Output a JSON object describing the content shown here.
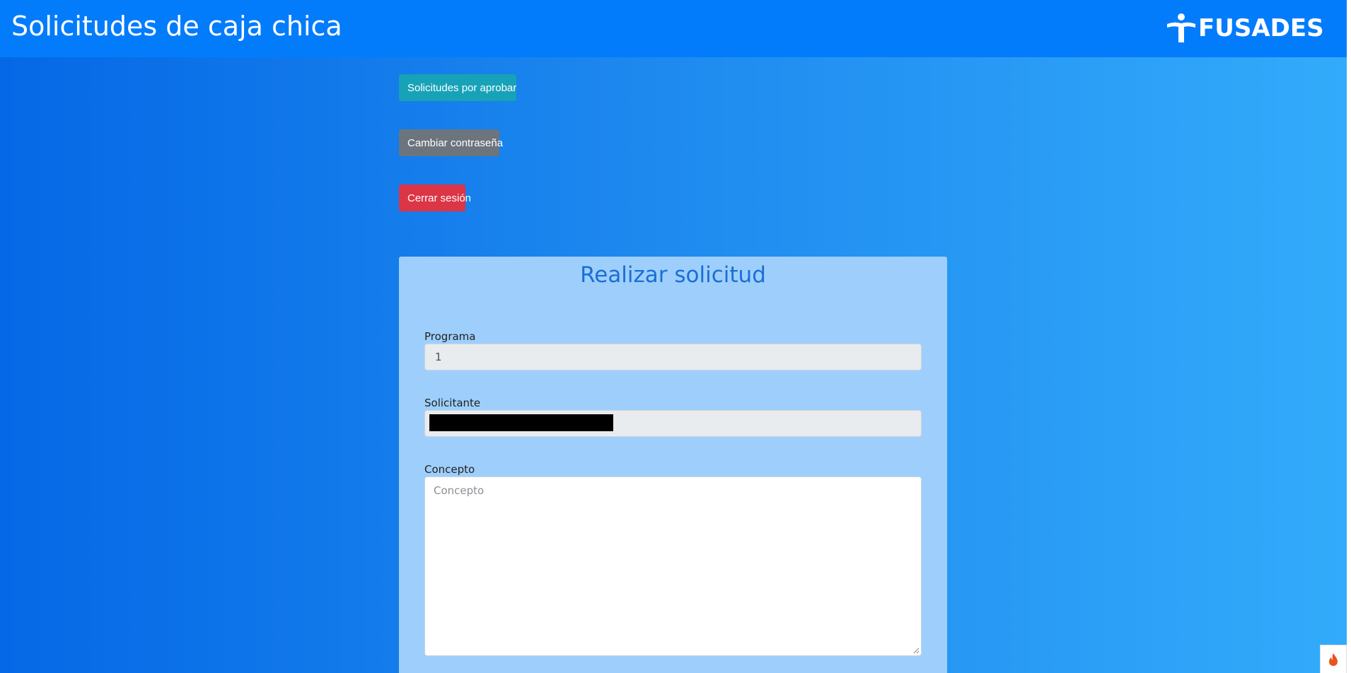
{
  "header": {
    "title": "Solicitudes de caja chica",
    "logo_text": "FUSADES",
    "logo_icon": "person-logo-icon"
  },
  "actions": {
    "pending_requests_label": "Solicitudes por aprobar",
    "change_password_label": "Cambiar contraseña",
    "logout_label": "Cerrar sesión"
  },
  "form": {
    "title": "Realizar solicitud",
    "programa": {
      "label": "Programa",
      "value": "1"
    },
    "solicitante": {
      "label": "Solicitante",
      "value": ""
    },
    "concepto": {
      "label": "Concepto",
      "placeholder": "Concepto",
      "value": ""
    }
  },
  "colors": {
    "header_bg": "#037cfc",
    "info_button": "#17a2b8",
    "secondary_button": "#6c757d",
    "danger_button": "#dc3545",
    "card_bg": "#9ecffc",
    "card_title": "#1a6fd4"
  },
  "floating_widget": {
    "icon": "flame-icon"
  }
}
